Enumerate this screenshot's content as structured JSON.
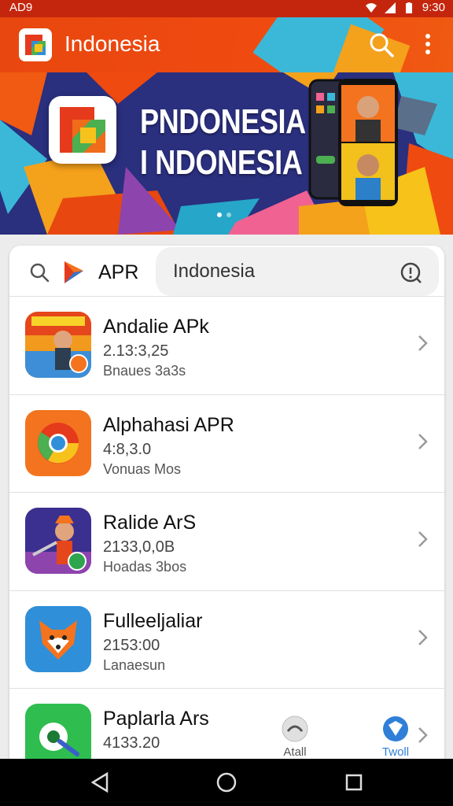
{
  "status_bar": {
    "left_text": "AD9",
    "time": "9:30",
    "icons": [
      "wifi-icon",
      "signal-icon",
      "battery-icon"
    ]
  },
  "app_bar": {
    "title": "Indonesia",
    "icons": [
      "search-icon",
      "more-vert-icon"
    ]
  },
  "hero": {
    "line1": "PNDONESIA",
    "line2": "I NDONESIA",
    "dots": 2,
    "active_dot": 0
  },
  "search": {
    "brand_label": "APR",
    "value": "Indonesia"
  },
  "apps": [
    {
      "name": "Andalie APk",
      "version": "2.13:3,25",
      "subtitle": "Bnaues 3a3s",
      "icon": "game-hero-icon"
    },
    {
      "name": "Alphahasi APR",
      "version": "4:8,3.0",
      "subtitle": "Vonuas Mos",
      "icon": "browser-icon"
    },
    {
      "name": "Ralide ArS",
      "version": "2133,0,0B",
      "subtitle": "Hoadas 3bos",
      "icon": "game-warrior-icon"
    },
    {
      "name": "Fulleeljaliar",
      "version": "2153:00",
      "subtitle": "Lanaesun",
      "icon": "fox-icon"
    },
    {
      "name": "Paplarla Ars",
      "version": "4133.20",
      "subtitle": "",
      "icon": "maps-icon"
    }
  ],
  "mini_tabs": [
    {
      "label": "Atall",
      "icon": "gauge-icon"
    },
    {
      "label": "Twoll",
      "icon": "shield-icon"
    }
  ],
  "colors": {
    "accent": "#ef4a10",
    "hero_bg": "#2a2f7e",
    "status": "#c4260d"
  }
}
